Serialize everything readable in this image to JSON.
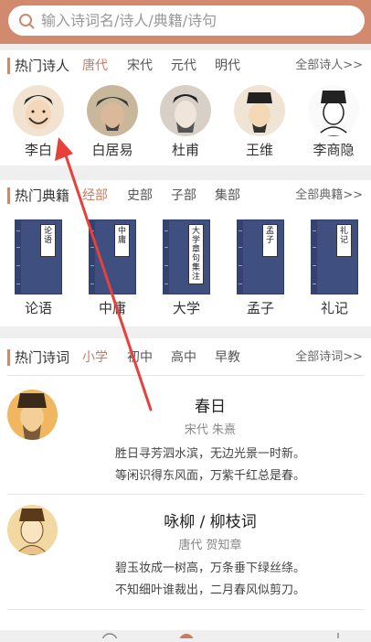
{
  "search": {
    "placeholder": "输入诗词名/诗人/典籍/诗句"
  },
  "poets": {
    "title": "热门诗人",
    "tabs": [
      "唐代",
      "宋代",
      "元代",
      "明代"
    ],
    "more": "全部诗人>>",
    "items": [
      {
        "name": "李白"
      },
      {
        "name": "白居易"
      },
      {
        "name": "杜甫"
      },
      {
        "name": "王维"
      },
      {
        "name": "李商隐"
      }
    ]
  },
  "classics": {
    "title": "热门典籍",
    "tabs": [
      "经部",
      "史部",
      "子部",
      "集部"
    ],
    "more": "全部典籍>>",
    "items": [
      {
        "name": "论语",
        "label": "论语"
      },
      {
        "name": "中庸",
        "label": "中庸"
      },
      {
        "name": "大学",
        "label": "大学章句集注"
      },
      {
        "name": "孟子",
        "label": "孟子"
      },
      {
        "name": "礼记",
        "label": "礼记"
      }
    ]
  },
  "poems": {
    "title": "热门诗词",
    "tabs": [
      "小学",
      "初中",
      "高中",
      "早教"
    ],
    "more": "全部诗词>>",
    "items": [
      {
        "title": "春日",
        "author": "宋代 朱熹",
        "lines": [
          "胜日寻芳泗水滨，无边光景一时新。",
          "等闲识得东风面，万紫千红总是春。"
        ]
      },
      {
        "title": "咏柳 / 柳枝词",
        "author": "唐代 贺知章",
        "lines": [
          "碧玉妆成一树高，万条垂下绿丝绦。",
          "不知细叶谁裁出，二月春风似剪刀。"
        ]
      }
    ]
  },
  "colors": {
    "header": "#d28a6e",
    "accent": "#c97c5f",
    "annotation": "#e8403a"
  }
}
